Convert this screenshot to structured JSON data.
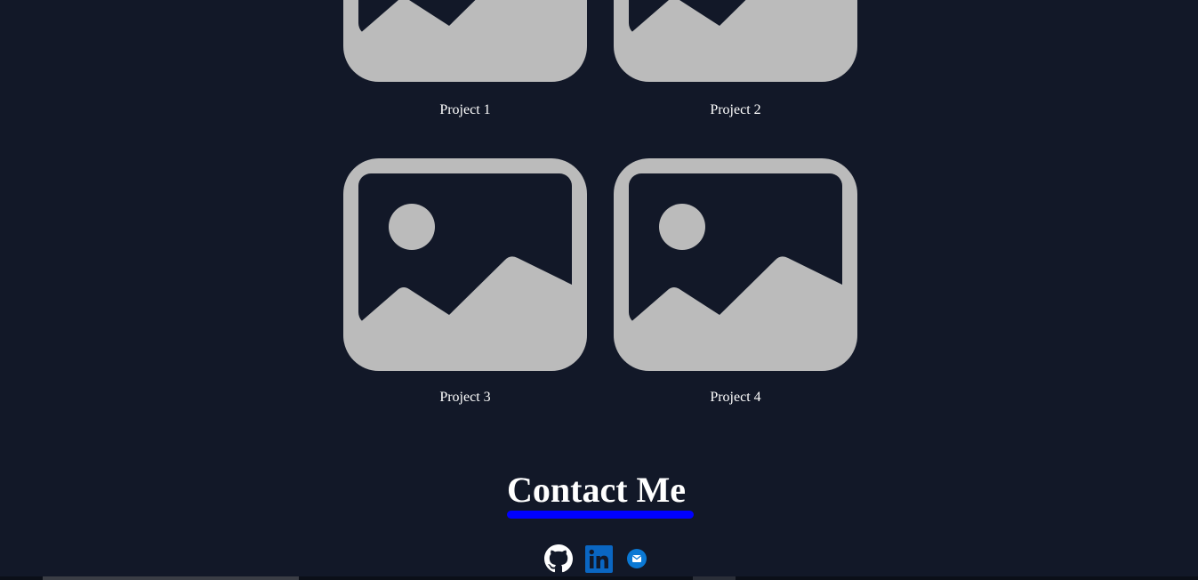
{
  "projects": [
    {
      "label": "Project 1"
    },
    {
      "label": "Project 2"
    },
    {
      "label": "Project 3"
    },
    {
      "label": "Project 4"
    }
  ],
  "contact": {
    "title": "Contact Me",
    "underline_color": "#0000ff"
  },
  "social": [
    {
      "name": "github-icon",
      "color": "#ffffff"
    },
    {
      "name": "linkedin-icon",
      "color": "#0a66c2"
    },
    {
      "name": "email-icon",
      "color": "#0a78d4"
    }
  ],
  "colors": {
    "background": "#121828",
    "placeholder": "#bbbbbb"
  }
}
